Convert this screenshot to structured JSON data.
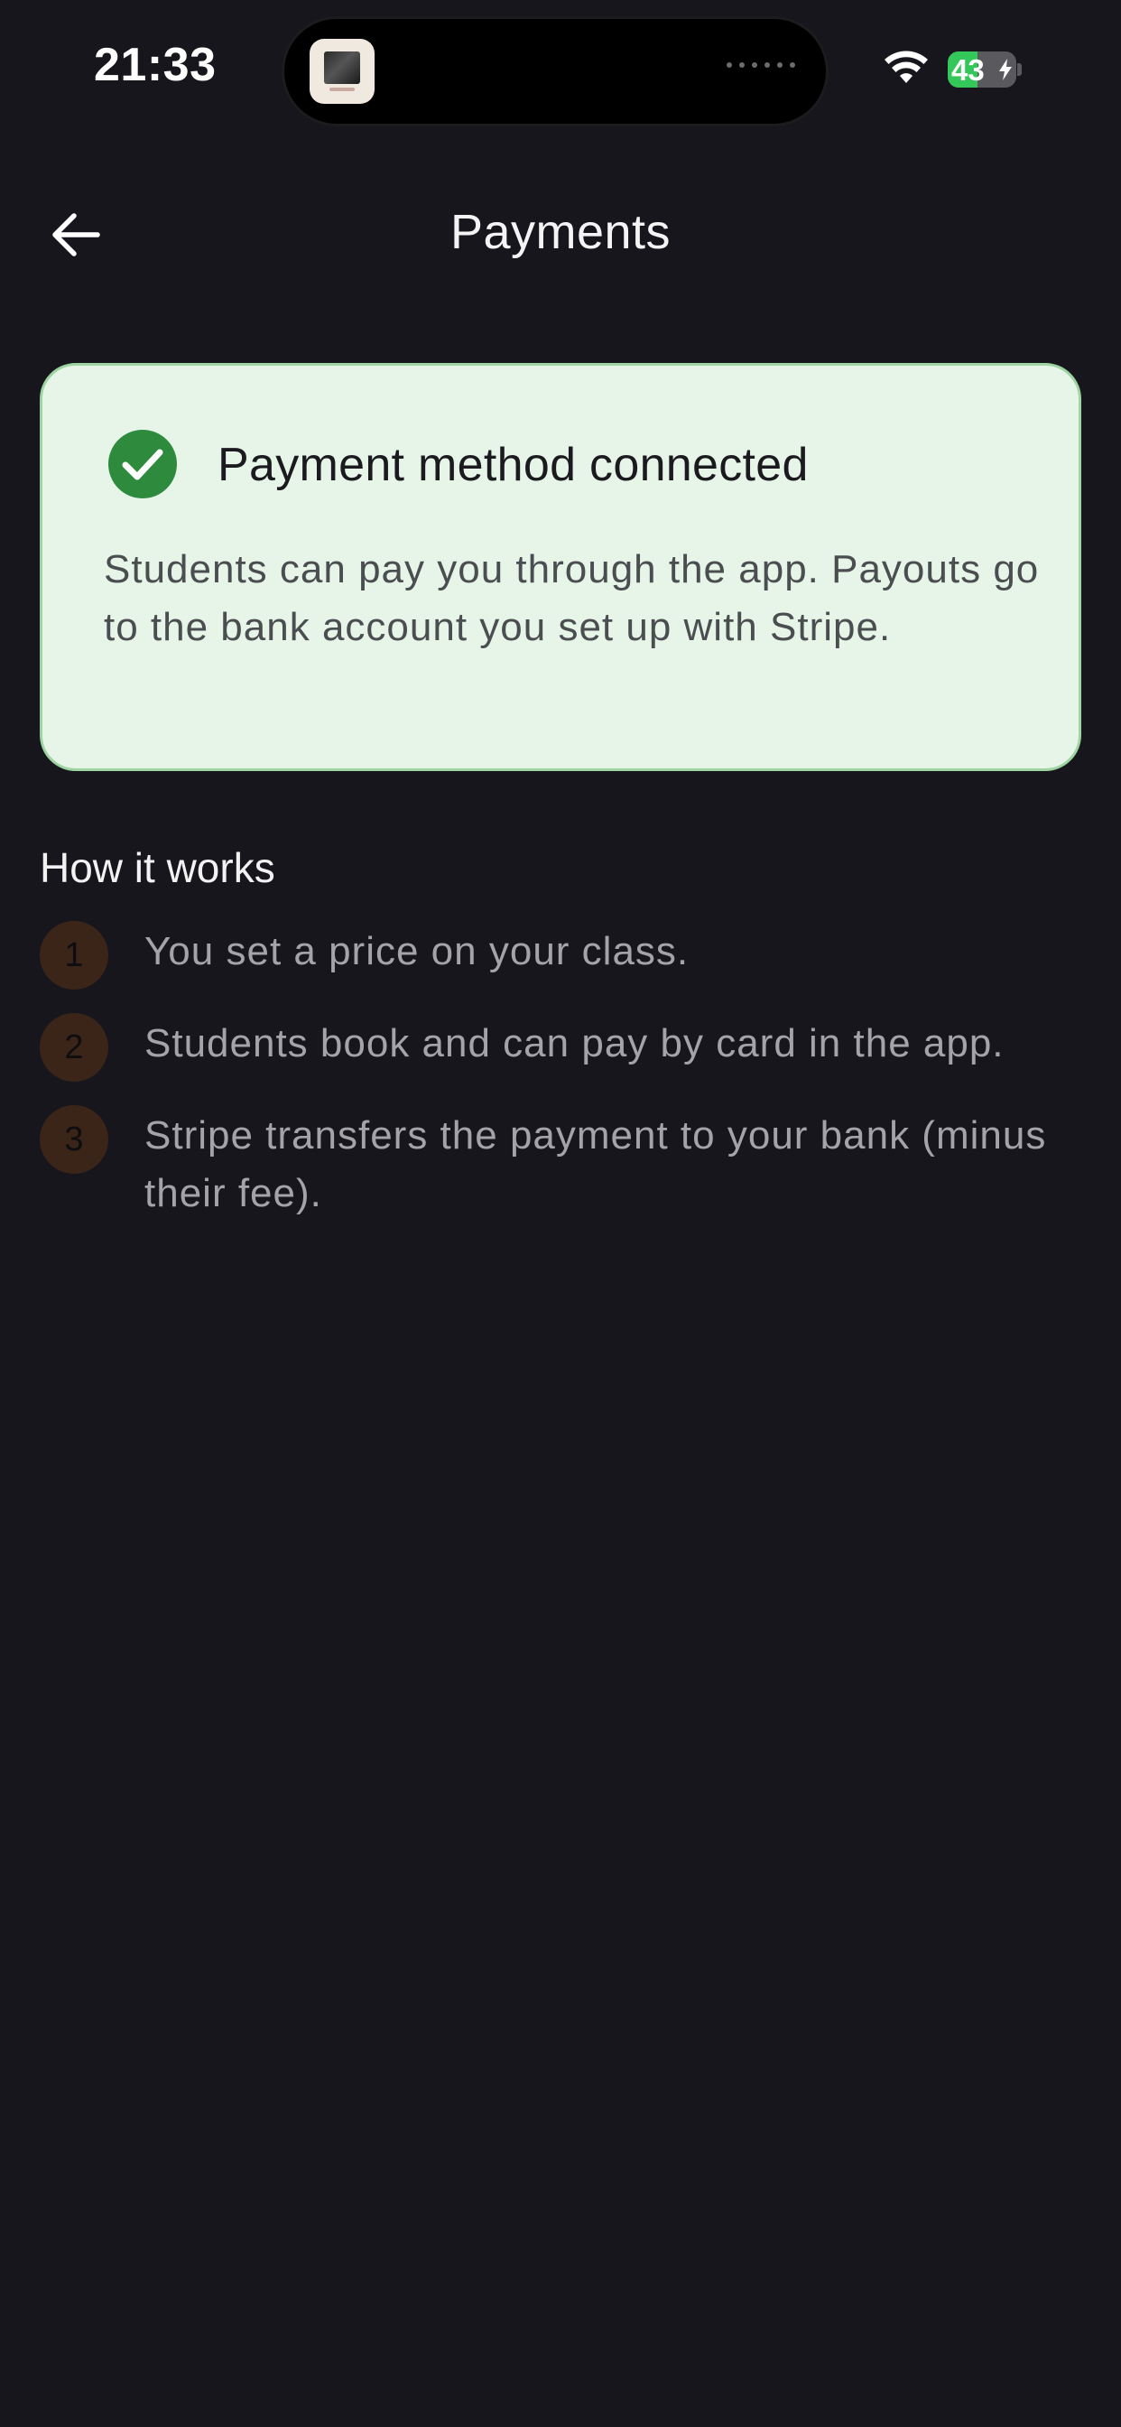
{
  "status_bar": {
    "time": "21:33",
    "battery_level": "43",
    "battery_fraction": 0.43,
    "battery_charging": true,
    "icons": [
      "wifi-icon",
      "battery-icon",
      "charging-bolt-icon"
    ]
  },
  "header": {
    "title": "Payments",
    "back_icon": "arrow-left-icon"
  },
  "connected_card": {
    "icon": "check-circle-icon",
    "title": "Payment method connected",
    "body": "Students can pay you through the app. Payouts go to the bank account you set up with Stripe.",
    "colors": {
      "background": "#e7f5e8",
      "border": "#9ed3a2",
      "check": "#2e8b3e"
    }
  },
  "how_it_works": {
    "title": "How it works",
    "steps": [
      {
        "number": "1",
        "text": "You set a price on your class."
      },
      {
        "number": "2",
        "text": "Students book and can pay by card in the app."
      },
      {
        "number": "3",
        "text": "Stripe transfers the payment to your bank (minus their fee)."
      }
    ],
    "badge_color": "#3b2519"
  },
  "theme": {
    "background": "#17161c",
    "text_primary": "#f4f4f6",
    "text_secondary": "#a3a3a8"
  }
}
